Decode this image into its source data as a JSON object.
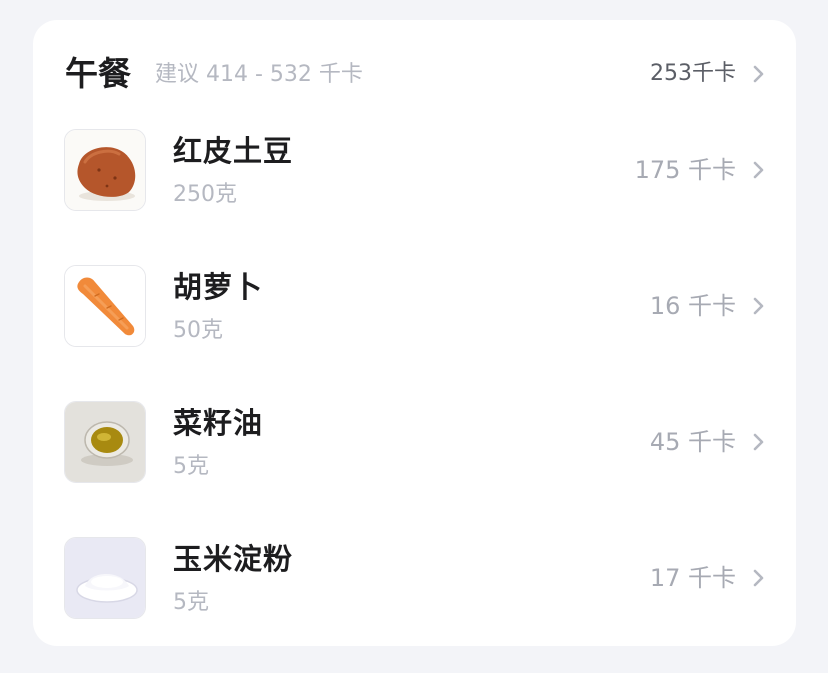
{
  "meal": {
    "title": "午餐",
    "suggestion": "建议 414 - 532 千卡",
    "total_kcal": "253千卡"
  },
  "foods": [
    {
      "name": "红皮土豆",
      "weight": "250克",
      "kcal": "175 千卡",
      "icon": "potato-icon"
    },
    {
      "name": "胡萝卜",
      "weight": "50克",
      "kcal": "16 千卡",
      "icon": "carrot-icon"
    },
    {
      "name": "菜籽油",
      "weight": "5克",
      "kcal": "45 千卡",
      "icon": "oil-bowl-icon"
    },
    {
      "name": "玉米淀粉",
      "weight": "5克",
      "kcal": "17 千卡",
      "icon": "starch-icon"
    }
  ],
  "colors": {
    "background": "#f3f4f8",
    "card": "#ffffff",
    "title": "#1d1d1f",
    "muted": "#b5b8c1",
    "kcal": "#a7aab3"
  }
}
